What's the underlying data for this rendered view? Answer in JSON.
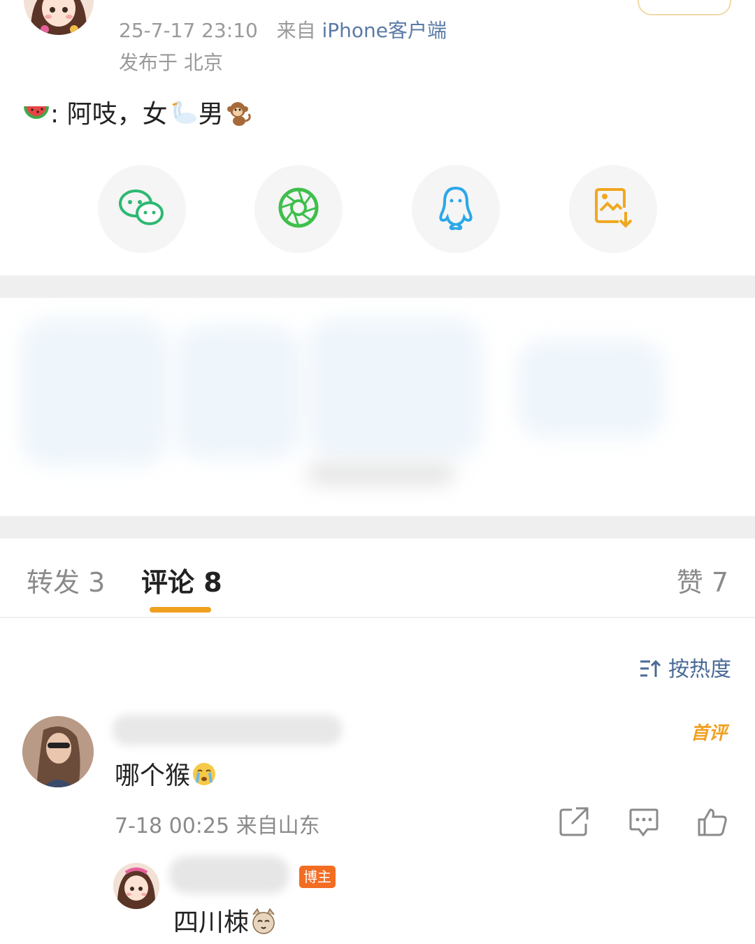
{
  "post": {
    "time": "25-7-17 23:10",
    "source_prefix": "来自",
    "source": "iPhone客户端",
    "location": "发布于 北京",
    "text_parts": [
      ": 阿吱，女",
      "男"
    ],
    "emojis": [
      "watermelon-emoji",
      "swan-emoji",
      "monkey-emoji"
    ]
  },
  "share": {
    "items": [
      "wechat-icon",
      "moments-icon",
      "qq-icon",
      "save-image-icon"
    ],
    "colors": {
      "wechat": "#2eb872",
      "moments": "#3fbf4c",
      "qq": "#2aa8e8",
      "save": "#f0a820"
    }
  },
  "tabs": {
    "repost": "转发 3",
    "comments": "评论 8",
    "likes": "赞 7"
  },
  "sort_label": "按热度",
  "comment": {
    "badge": "首评",
    "text": "哪个猴",
    "time_loc": "7-18 00:25 来自山东"
  },
  "reply": {
    "badge": "博主",
    "text": "四川栜"
  },
  "colors": {
    "accent": "#f0a020",
    "link": "#4a6a96",
    "meta": "#9a9a9a",
    "blogger_badge": "#f26d22"
  }
}
